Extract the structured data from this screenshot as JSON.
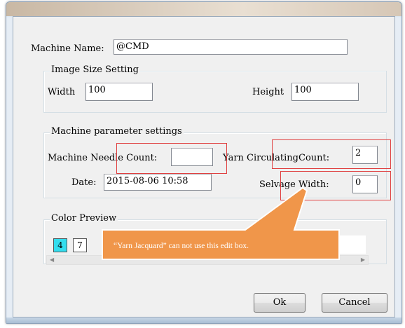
{
  "dialog": {
    "machine_name_label": "Machine Name:",
    "machine_name_value": "@CMD"
  },
  "image_size": {
    "title": "Image Size Setting",
    "width_label": "Width",
    "width_value": "100",
    "height_label": "Height",
    "height_value": "100"
  },
  "machine_params": {
    "title": "Machine parameter settings",
    "needle_count_label": "Machine Needle Count:",
    "needle_count_value": "",
    "yarn_count_label": "Yarn CirculatingCount:",
    "yarn_count_value": "2",
    "date_label": "Date:",
    "date_value": "2015-08-06 10:58",
    "selvage_label": "Selvage Width:",
    "selvage_value": "0"
  },
  "color_preview": {
    "title": "Color Preview",
    "swatches": [
      {
        "label": "4",
        "color": "#33ddee"
      },
      {
        "label": "7",
        "color": "#ffffff"
      }
    ]
  },
  "buttons": {
    "ok": "Ok",
    "cancel": "Cancel"
  },
  "annotation": {
    "callout_text": "“Yarn Jacquard”   can not use this edit box.",
    "callout_color": "#f0964a",
    "highlight_color": "#e04040"
  }
}
